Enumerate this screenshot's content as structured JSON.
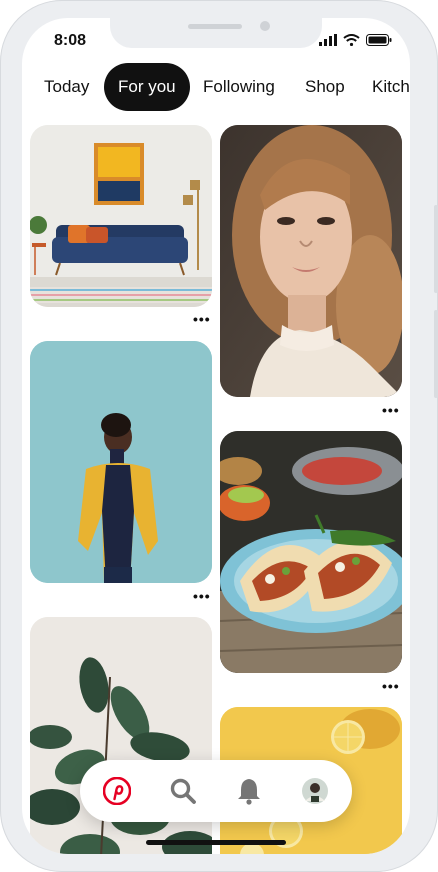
{
  "status_bar": {
    "time": "8:08"
  },
  "tabs": [
    {
      "label": "Today",
      "active": false
    },
    {
      "label": "For you",
      "active": true
    },
    {
      "label": "Following",
      "active": false
    },
    {
      "label": "Shop",
      "active": false
    },
    {
      "label": "Kitch",
      "active": false
    }
  ],
  "pins": [
    {
      "name": "living-room-pin",
      "menu": "•••"
    },
    {
      "name": "portrait-woman-pin",
      "menu": "•••"
    },
    {
      "name": "yellow-jacket-model-pin",
      "menu": "•••"
    },
    {
      "name": "tacos-pin",
      "menu": "•••"
    },
    {
      "name": "plant-pin",
      "menu": ""
    },
    {
      "name": "lemons-pin",
      "menu": ""
    }
  ],
  "bottom_nav": [
    {
      "icon": "pinterest-logo-icon",
      "active": true
    },
    {
      "icon": "search-icon",
      "active": false
    },
    {
      "icon": "bell-icon",
      "active": false
    },
    {
      "icon": "profile-avatar-icon",
      "active": false
    }
  ],
  "colors": {
    "accent": "#e60023",
    "tab_active_bg": "#111111",
    "frame": "#eceef1"
  }
}
